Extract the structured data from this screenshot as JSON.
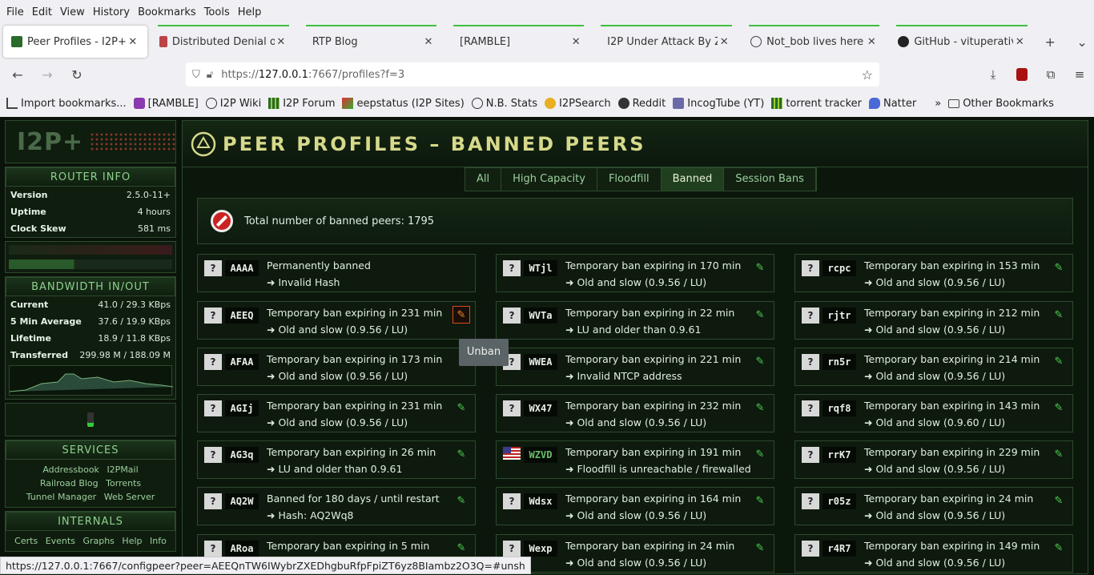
{
  "menu": [
    "File",
    "Edit",
    "View",
    "History",
    "Bookmarks",
    "Tools",
    "Help"
  ],
  "tabs": [
    {
      "title": "Peer Profiles - I2P+",
      "active": true
    },
    {
      "title": "Distributed Denial o",
      "active": false
    },
    {
      "title": "RTP Blog",
      "active": false
    },
    {
      "title": "[RAMBLE]",
      "active": false
    },
    {
      "title": "I2P Under Attack By Zo",
      "active": false
    },
    {
      "title": "Not_bob lives here",
      "active": false
    },
    {
      "title": "GitHub - vituperativ",
      "active": false
    }
  ],
  "url": {
    "prefix": "https://",
    "host": "127.0.0.1",
    "rest": ":7667/profiles?f=3"
  },
  "bookmarks": [
    "Import bookmarks...",
    "[RAMBLE]",
    "I2P Wiki",
    "I2P Forum",
    "eepstatus (I2P Sites)",
    "N.B. Stats",
    "I2PSearch",
    "Reddit",
    "IncogTube (YT)",
    "torrent tracker",
    "Natter",
    "Other Bookmarks"
  ],
  "sidebar": {
    "logo": "I2P+",
    "router_info": {
      "heading": "ROUTER INFO",
      "rows": [
        {
          "label": "Version",
          "value": "2.5.0-11+"
        },
        {
          "label": "Uptime",
          "value": "4 hours"
        },
        {
          "label": "Clock Skew",
          "value": "581 ms"
        }
      ]
    },
    "bandwidth": {
      "heading": "BANDWIDTH IN/OUT",
      "rows": [
        {
          "label": "Current",
          "value": "41.0 / 29.3 KBps"
        },
        {
          "label": "5 Min Average",
          "value": "37.6 / 19.9 KBps"
        },
        {
          "label": "Lifetime",
          "value": "18.9 / 11.8 KBps"
        },
        {
          "label": "Transferred",
          "value": "299.98 M / 188.09 M"
        }
      ]
    },
    "services": {
      "heading": "SERVICES",
      "links": [
        "Addressbook",
        "I2PMail",
        "Railroad Blog",
        "Torrents",
        "Tunnel Manager",
        "Web Server"
      ]
    },
    "internals": {
      "heading": "INTERNALS",
      "links": [
        "Certs",
        "Events",
        "Graphs",
        "Help",
        "Info"
      ]
    }
  },
  "main": {
    "title": "PEER PROFILES – BANNED PEERS",
    "subnav": [
      "All",
      "High Capacity",
      "Floodfill",
      "Banned",
      "Session Bans"
    ],
    "active_subnav": "Banned",
    "total": "Total number of banned peers: 1795"
  },
  "peers": [
    [
      {
        "hash": "AAAA",
        "line1": "Permanently banned",
        "line2": "➜ Invalid Hash",
        "flag": "?",
        "edit": false
      },
      {
        "hash": "AEEQ",
        "line1": "Temporary ban expiring in 231 min",
        "line2": "➜ Old and slow (0.9.56 / LU)",
        "flag": "?",
        "edit": true,
        "highlight": true
      },
      {
        "hash": "AFAA",
        "line1": "Temporary ban expiring in 173 min",
        "line2": "➜ Old and slow (0.9.56 / LU)",
        "flag": "?",
        "edit": false
      },
      {
        "hash": "AGIj",
        "line1": "Temporary ban expiring in 231 min",
        "line2": "➜ Old and slow (0.9.56 / LU)",
        "flag": "?",
        "edit": true
      },
      {
        "hash": "AG3q",
        "line1": "Temporary ban expiring in 26 min",
        "line2": "➜ LU and older than 0.9.61",
        "flag": "?",
        "edit": true
      },
      {
        "hash": "AQ2W",
        "line1": "Banned for 180 days / until restart",
        "line2": "➜ Hash: AQ2Wq8",
        "flag": "?",
        "edit": true
      },
      {
        "hash": "ARoa",
        "line1": "Temporary ban expiring in 5 min",
        "line2": "",
        "flag": "?",
        "edit": true
      }
    ],
    [
      {
        "hash": "WTjl",
        "line1": "Temporary ban expiring in 170 min",
        "line2": "➜ Old and slow (0.9.56 / LU)",
        "flag": "?",
        "edit": true
      },
      {
        "hash": "WVTa",
        "line1": "Temporary ban expiring in 22 min",
        "line2": "➜ LU and older than 0.9.61",
        "flag": "?",
        "edit": true
      },
      {
        "hash": "WWEA",
        "line1": "Temporary ban expiring in 221 min",
        "line2": "➜ Invalid NTCP address",
        "flag": "?",
        "edit": true
      },
      {
        "hash": "WX47",
        "line1": "Temporary ban expiring in 232 min",
        "line2": "➜ Old and slow (0.9.56 / LU)",
        "flag": "?",
        "edit": true
      },
      {
        "hash": "WZVD",
        "line1": "Temporary ban expiring in 191 min",
        "line2": "➜ Floodfill is unreachable / firewalled",
        "flag": "us",
        "edit": true
      },
      {
        "hash": "Wdsx",
        "line1": "Temporary ban expiring in 164 min",
        "line2": "➜ Old and slow (0.9.56 / LU)",
        "flag": "?",
        "edit": true
      },
      {
        "hash": "Wexp",
        "line1": "Temporary ban expiring in 24 min",
        "line2": "➜ Old and slow (0.9.56 / LU)",
        "flag": "?",
        "edit": true
      }
    ],
    [
      {
        "hash": "rcpc",
        "line1": "Temporary ban expiring in 153 min",
        "line2": "➜ Old and slow (0.9.56 / LU)",
        "flag": "?",
        "edit": true
      },
      {
        "hash": "rjtr",
        "line1": "Temporary ban expiring in 212 min",
        "line2": "➜ Old and slow (0.9.56 / LU)",
        "flag": "?",
        "edit": true
      },
      {
        "hash": "rn5r",
        "line1": "Temporary ban expiring in 214 min",
        "line2": "➜ Old and slow (0.9.56 / LU)",
        "flag": "?",
        "edit": true
      },
      {
        "hash": "rqf8",
        "line1": "Temporary ban expiring in 143 min",
        "line2": "➜ Old and slow (0.9.60 / LU)",
        "flag": "?",
        "edit": true
      },
      {
        "hash": "rrK7",
        "line1": "Temporary ban expiring in 229 min",
        "line2": "➜ Old and slow (0.9.56 / LU)",
        "flag": "?",
        "edit": true
      },
      {
        "hash": "r05z",
        "line1": "Temporary ban expiring in 24 min",
        "line2": "➜ Old and slow (0.9.56 / LU)",
        "flag": "?",
        "edit": true
      },
      {
        "hash": "r4R7",
        "line1": "Temporary ban expiring in 149 min",
        "line2": "➜ Old and slow (0.9.56 / LU)",
        "flag": "?",
        "edit": true
      }
    ]
  ],
  "tooltip": "Unban",
  "status_url": "https://127.0.0.1:7667/configpeer?peer=AEEQnTW6IWybrZXEDhgbuRfpFpiZT6yz8BIambz2O3Q=#unsh"
}
